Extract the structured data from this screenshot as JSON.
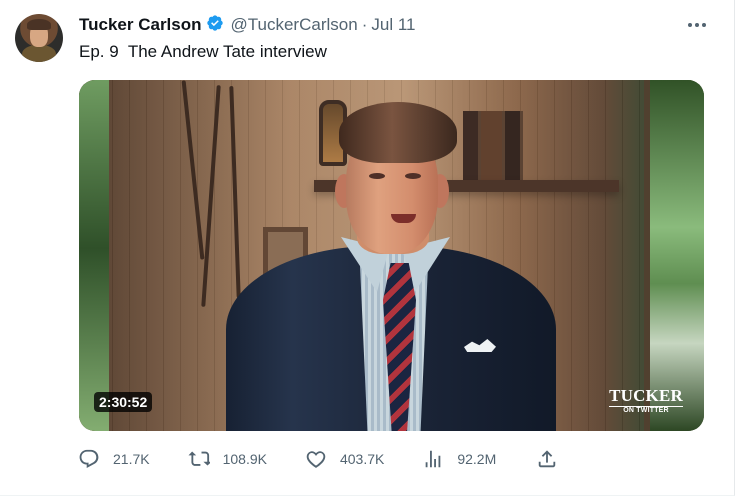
{
  "tweet": {
    "author_name": "Tucker Carlson",
    "handle": "@TuckerCarlson",
    "date_separator": "·",
    "date": "Jul 11",
    "text": "Ep. 9  The Andrew Tate interview",
    "media": {
      "duration": "2:30:52",
      "watermark_main": "TUCKER",
      "watermark_sub": "ON TWITTER"
    },
    "metrics": {
      "replies": "21.7K",
      "retweets": "108.9K",
      "likes": "403.7K",
      "views": "92.2M"
    }
  },
  "icons": {
    "verified": "verified-badge-icon",
    "more": "more-options-icon",
    "reply": "reply-icon",
    "retweet": "retweet-icon",
    "like": "heart-icon",
    "views": "views-chart-icon",
    "share": "share-icon"
  },
  "colors": {
    "primary_text": "#0f1419",
    "secondary_text": "#536471",
    "verified_blue": "#1d9bf0"
  }
}
